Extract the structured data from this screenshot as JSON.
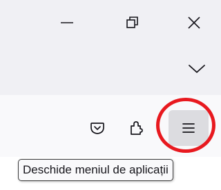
{
  "window_controls": {
    "minimize": "minimize-icon",
    "restore": "restore-icon",
    "close": "close-icon"
  },
  "tabs_menu": {
    "icon": "chevron-down-icon"
  },
  "toolbar": {
    "pocket_icon": "pocket-icon",
    "extensions_icon": "extensions-icon",
    "app_menu_icon": "hamburger-menu-icon"
  },
  "tooltip": {
    "text": "Deschide meniul de aplicații"
  },
  "colors": {
    "titlebar_bg": "#f0f0f4",
    "toolbar_bg": "#f9f9fb",
    "highlight": "#e8191f",
    "icon": "#15141a"
  }
}
